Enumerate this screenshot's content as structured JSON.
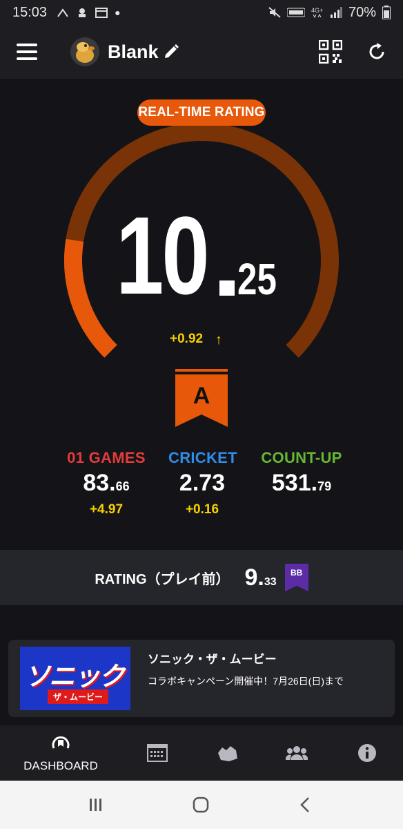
{
  "status_bar": {
    "time": "15:03",
    "battery": "70%"
  },
  "header": {
    "username": "Blank"
  },
  "rating": {
    "badge": "REAL-TIME RATING",
    "integer": "10",
    "decimal": "25",
    "delta": "+0.92",
    "class": "A",
    "gauge_fraction": 0.2
  },
  "stats": [
    {
      "title": "01 GAMES",
      "value_int": "83.",
      "value_dec": "66",
      "change": "+4.97",
      "color": "#e23b3b"
    },
    {
      "title": "CRICKET",
      "value_int": "2.73",
      "value_dec": "",
      "change": "+0.16",
      "color": "#2f8ce8"
    },
    {
      "title": "COUNT-UP",
      "value_int": "531.",
      "value_dec": "79",
      "change": "",
      "color": "#66b832"
    }
  ],
  "previous": {
    "label": "RATING（プレイ前）",
    "value_int": "9.",
    "value_dec": "33",
    "class": "BB"
  },
  "banner": {
    "title": "ソニック・ザ・ムービー",
    "description": "コラボキャンペーン開催中！7月26日(日)まで",
    "image_text": "ソニック",
    "image_sub": "ザ・ムービー"
  },
  "nav": {
    "dashboard": "DASHBOARD"
  },
  "colors": {
    "accent": "#e8580a",
    "arc_dim": "#7a3306",
    "yellow": "#f5d000",
    "bb_purple": "#5b2ca6"
  }
}
